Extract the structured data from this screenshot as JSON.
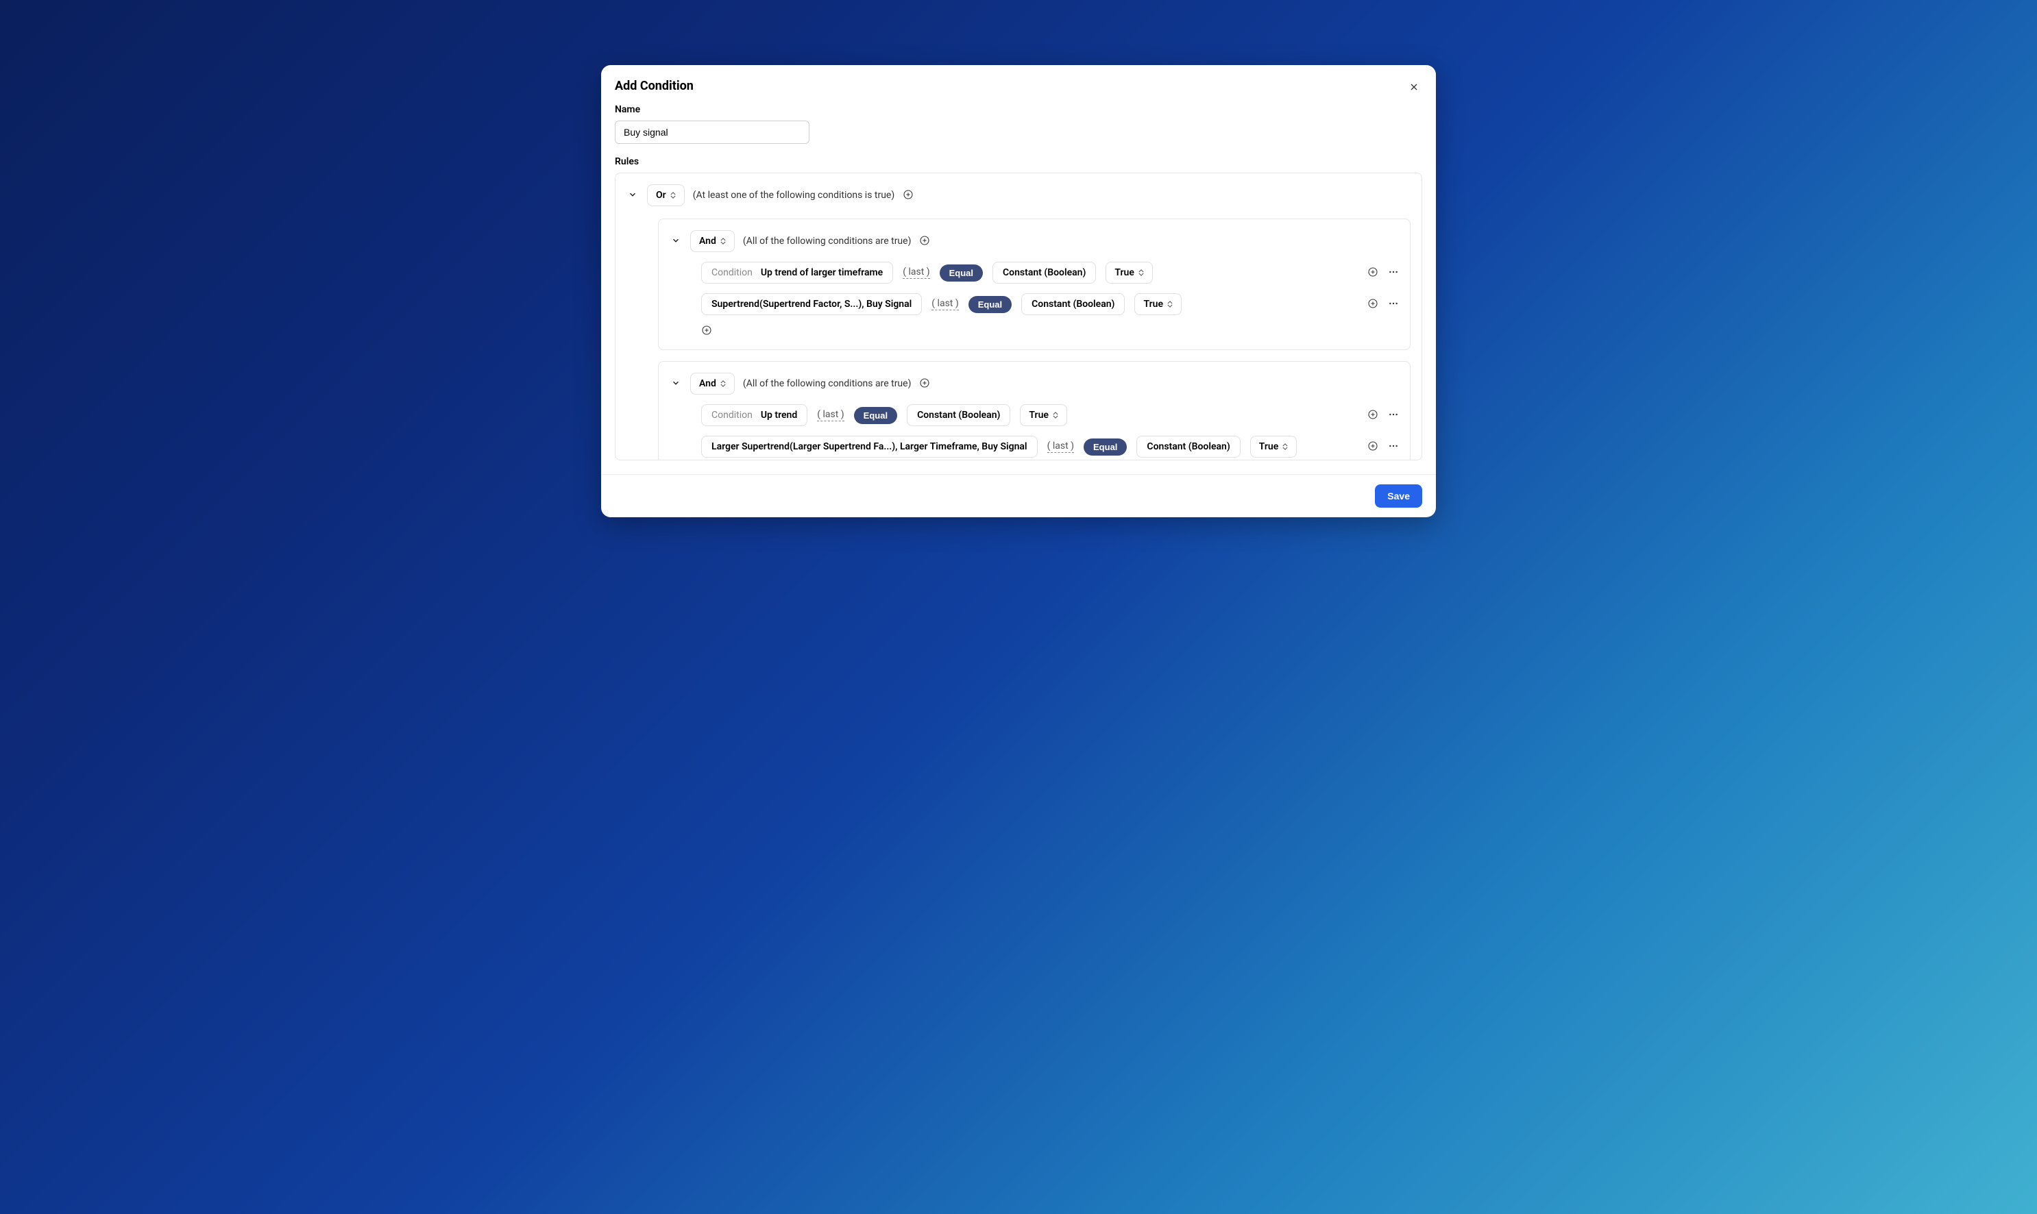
{
  "dialog": {
    "title": "Add Condition"
  },
  "form": {
    "name_label": "Name",
    "name_value": "Buy signal",
    "rules_label": "Rules"
  },
  "root_group": {
    "operator": "Or",
    "hint": "(At least one of the following conditions is true)"
  },
  "groups": [
    {
      "operator": "And",
      "hint": "(All of the following conditions are true)",
      "lines": [
        {
          "prefix": "Condition",
          "text": "Up trend of larger timeframe",
          "marker": "( last )",
          "op": "Equal",
          "rhs_type": "Constant (Boolean)",
          "rhs_value": "True"
        },
        {
          "prefix": null,
          "text": "Supertrend(Supertrend Factor, S...), Buy Signal",
          "marker": "( last )",
          "op": "Equal",
          "rhs_type": "Constant (Boolean)",
          "rhs_value": "True"
        }
      ]
    },
    {
      "operator": "And",
      "hint": "(All of the following conditions are true)",
      "lines": [
        {
          "prefix": "Condition",
          "text": "Up trend",
          "marker": "( last )",
          "op": "Equal",
          "rhs_type": "Constant (Boolean)",
          "rhs_value": "True"
        },
        {
          "prefix": null,
          "text": "Larger Supertrend(Larger Supertrend Fa...), Larger Timeframe, Buy Signal",
          "marker": "( last )",
          "op": "Equal",
          "rhs_type": "Constant (Boolean)",
          "rhs_value": "True"
        }
      ]
    }
  ],
  "footer": {
    "save": "Save"
  }
}
